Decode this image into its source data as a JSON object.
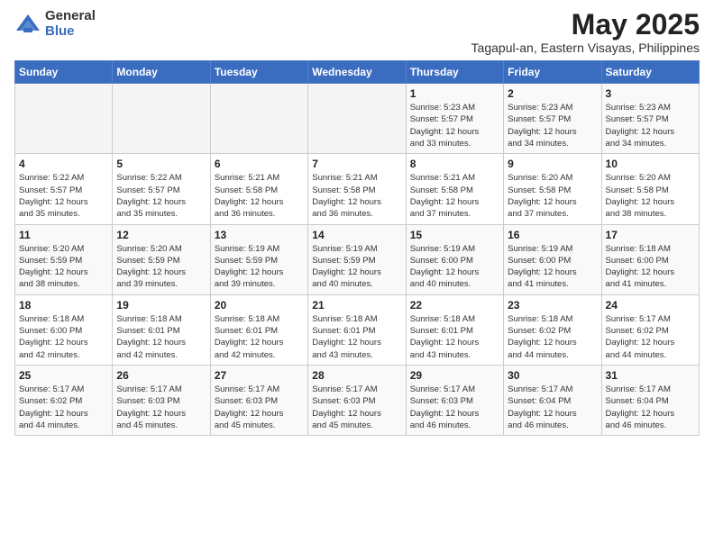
{
  "logo": {
    "general": "General",
    "blue": "Blue"
  },
  "title": "May 2025",
  "subtitle": "Tagapul-an, Eastern Visayas, Philippines",
  "days_of_week": [
    "Sunday",
    "Monday",
    "Tuesday",
    "Wednesday",
    "Thursday",
    "Friday",
    "Saturday"
  ],
  "weeks": [
    [
      {
        "day": "",
        "info": ""
      },
      {
        "day": "",
        "info": ""
      },
      {
        "day": "",
        "info": ""
      },
      {
        "day": "",
        "info": ""
      },
      {
        "day": "1",
        "info": "Sunrise: 5:23 AM\nSunset: 5:57 PM\nDaylight: 12 hours\nand 33 minutes."
      },
      {
        "day": "2",
        "info": "Sunrise: 5:23 AM\nSunset: 5:57 PM\nDaylight: 12 hours\nand 34 minutes."
      },
      {
        "day": "3",
        "info": "Sunrise: 5:23 AM\nSunset: 5:57 PM\nDaylight: 12 hours\nand 34 minutes."
      }
    ],
    [
      {
        "day": "4",
        "info": "Sunrise: 5:22 AM\nSunset: 5:57 PM\nDaylight: 12 hours\nand 35 minutes."
      },
      {
        "day": "5",
        "info": "Sunrise: 5:22 AM\nSunset: 5:57 PM\nDaylight: 12 hours\nand 35 minutes."
      },
      {
        "day": "6",
        "info": "Sunrise: 5:21 AM\nSunset: 5:58 PM\nDaylight: 12 hours\nand 36 minutes."
      },
      {
        "day": "7",
        "info": "Sunrise: 5:21 AM\nSunset: 5:58 PM\nDaylight: 12 hours\nand 36 minutes."
      },
      {
        "day": "8",
        "info": "Sunrise: 5:21 AM\nSunset: 5:58 PM\nDaylight: 12 hours\nand 37 minutes."
      },
      {
        "day": "9",
        "info": "Sunrise: 5:20 AM\nSunset: 5:58 PM\nDaylight: 12 hours\nand 37 minutes."
      },
      {
        "day": "10",
        "info": "Sunrise: 5:20 AM\nSunset: 5:58 PM\nDaylight: 12 hours\nand 38 minutes."
      }
    ],
    [
      {
        "day": "11",
        "info": "Sunrise: 5:20 AM\nSunset: 5:59 PM\nDaylight: 12 hours\nand 38 minutes."
      },
      {
        "day": "12",
        "info": "Sunrise: 5:20 AM\nSunset: 5:59 PM\nDaylight: 12 hours\nand 39 minutes."
      },
      {
        "day": "13",
        "info": "Sunrise: 5:19 AM\nSunset: 5:59 PM\nDaylight: 12 hours\nand 39 minutes."
      },
      {
        "day": "14",
        "info": "Sunrise: 5:19 AM\nSunset: 5:59 PM\nDaylight: 12 hours\nand 40 minutes."
      },
      {
        "day": "15",
        "info": "Sunrise: 5:19 AM\nSunset: 6:00 PM\nDaylight: 12 hours\nand 40 minutes."
      },
      {
        "day": "16",
        "info": "Sunrise: 5:19 AM\nSunset: 6:00 PM\nDaylight: 12 hours\nand 41 minutes."
      },
      {
        "day": "17",
        "info": "Sunrise: 5:18 AM\nSunset: 6:00 PM\nDaylight: 12 hours\nand 41 minutes."
      }
    ],
    [
      {
        "day": "18",
        "info": "Sunrise: 5:18 AM\nSunset: 6:00 PM\nDaylight: 12 hours\nand 42 minutes."
      },
      {
        "day": "19",
        "info": "Sunrise: 5:18 AM\nSunset: 6:01 PM\nDaylight: 12 hours\nand 42 minutes."
      },
      {
        "day": "20",
        "info": "Sunrise: 5:18 AM\nSunset: 6:01 PM\nDaylight: 12 hours\nand 42 minutes."
      },
      {
        "day": "21",
        "info": "Sunrise: 5:18 AM\nSunset: 6:01 PM\nDaylight: 12 hours\nand 43 minutes."
      },
      {
        "day": "22",
        "info": "Sunrise: 5:18 AM\nSunset: 6:01 PM\nDaylight: 12 hours\nand 43 minutes."
      },
      {
        "day": "23",
        "info": "Sunrise: 5:18 AM\nSunset: 6:02 PM\nDaylight: 12 hours\nand 44 minutes."
      },
      {
        "day": "24",
        "info": "Sunrise: 5:17 AM\nSunset: 6:02 PM\nDaylight: 12 hours\nand 44 minutes."
      }
    ],
    [
      {
        "day": "25",
        "info": "Sunrise: 5:17 AM\nSunset: 6:02 PM\nDaylight: 12 hours\nand 44 minutes."
      },
      {
        "day": "26",
        "info": "Sunrise: 5:17 AM\nSunset: 6:03 PM\nDaylight: 12 hours\nand 45 minutes."
      },
      {
        "day": "27",
        "info": "Sunrise: 5:17 AM\nSunset: 6:03 PM\nDaylight: 12 hours\nand 45 minutes."
      },
      {
        "day": "28",
        "info": "Sunrise: 5:17 AM\nSunset: 6:03 PM\nDaylight: 12 hours\nand 45 minutes."
      },
      {
        "day": "29",
        "info": "Sunrise: 5:17 AM\nSunset: 6:03 PM\nDaylight: 12 hours\nand 46 minutes."
      },
      {
        "day": "30",
        "info": "Sunrise: 5:17 AM\nSunset: 6:04 PM\nDaylight: 12 hours\nand 46 minutes."
      },
      {
        "day": "31",
        "info": "Sunrise: 5:17 AM\nSunset: 6:04 PM\nDaylight: 12 hours\nand 46 minutes."
      }
    ]
  ]
}
